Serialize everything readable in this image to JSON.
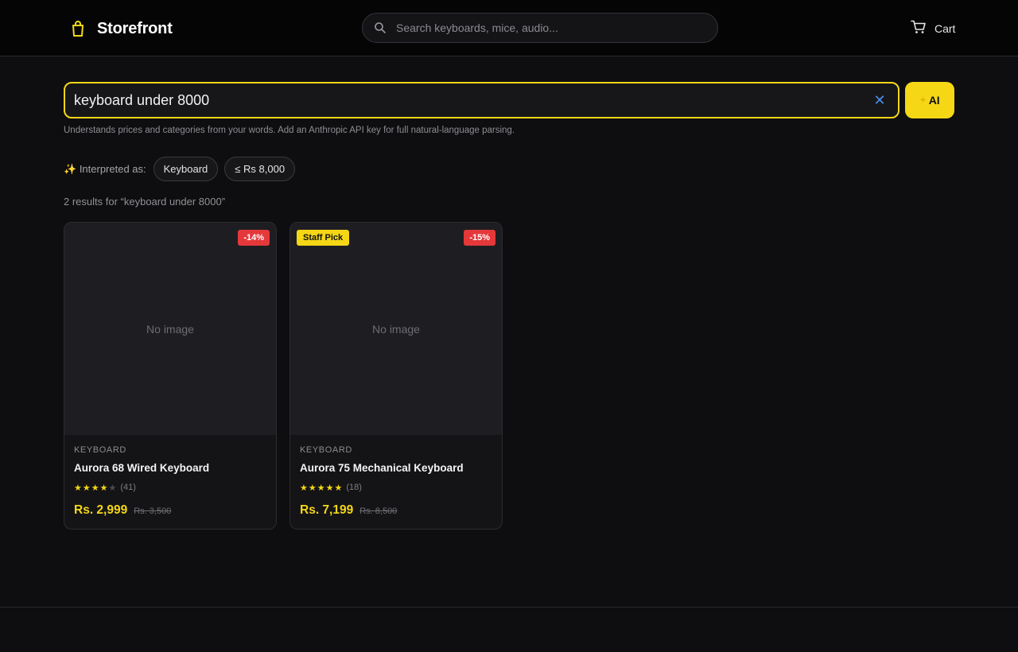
{
  "header": {
    "brand": "Storefront",
    "search_placeholder": "Search keyboards, mice, audio...",
    "cart_label": "Cart"
  },
  "ai_search": {
    "query": "keyboard under 8000",
    "clear_icon": "close-icon",
    "button_label": "AI",
    "hint": "Understands prices and categories from your words. Add an Anthropic API key for full natural-language parsing."
  },
  "interpretation": {
    "label": "Interpreted as:",
    "chips": [
      "Keyboard",
      "≤ Rs 8,000"
    ]
  },
  "results": {
    "count_text": "2 results for “keyboard under 8000”"
  },
  "products": [
    {
      "image_text": "No image",
      "discount": "-14%",
      "category": "KEYBOARD",
      "name": "Aurora 68 Wired Keyboard",
      "rating": 4,
      "rating_count": "(41)",
      "price": "Rs. 2,999",
      "old_price": "Rs. 3,500"
    },
    {
      "image_text": "No image",
      "badge": "Staff Pick",
      "discount": "-15%",
      "category": "KEYBOARD",
      "name": "Aurora 75 Mechanical Keyboard",
      "rating": 5,
      "rating_count": "(18)",
      "price": "Rs. 7,199",
      "old_price": "Rs. 8,500"
    }
  ],
  "colors": {
    "accent": "#f5d716",
    "discount": "#e5383b",
    "background": "#0e0e10"
  }
}
